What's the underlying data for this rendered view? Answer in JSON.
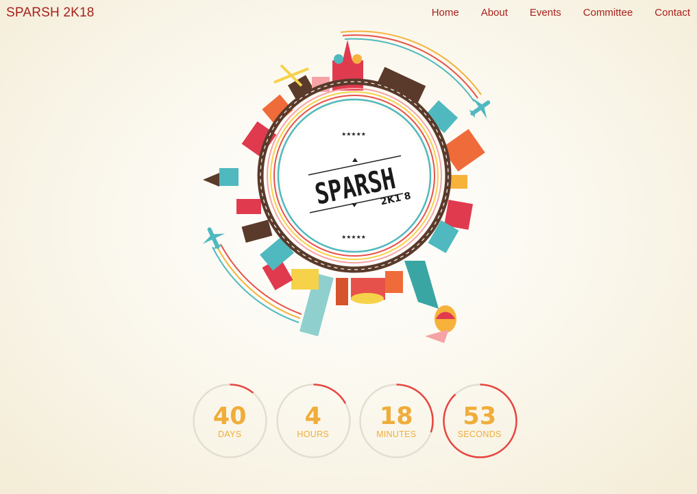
{
  "brand": "SPARSH 2K18",
  "nav": [
    "Home",
    "About",
    "Events",
    "Committee",
    "Contact"
  ],
  "logo": {
    "name": "SPARSH",
    "sub": "2K1 8",
    "stars": "★★★★★"
  },
  "countdown": [
    {
      "value": "40",
      "unit": "DAYS",
      "progress": 0.11
    },
    {
      "value": "4",
      "unit": "HOURS",
      "progress": 0.17
    },
    {
      "value": "18",
      "unit": "MINUTES",
      "progress": 0.3
    },
    {
      "value": "53",
      "unit": "SECONDS",
      "progress": 0.88
    }
  ],
  "colors": {
    "accent": "#a8201c",
    "number": "#f0ad3a",
    "ring": "#e7453f",
    "track": "#e4ded1"
  }
}
